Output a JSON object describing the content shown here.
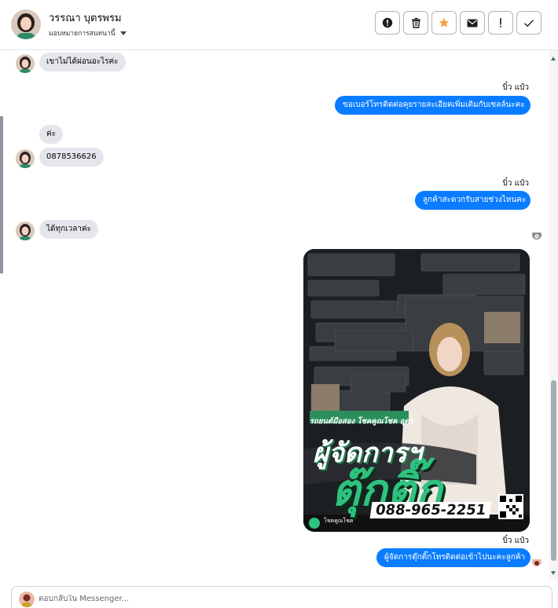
{
  "header": {
    "contact_name": "วรรณา บุตรพรม",
    "assign_label": "มอบหมายการสนทนานี้",
    "actions": [
      {
        "name": "report-button",
        "icon": "alert-circle-icon"
      },
      {
        "name": "delete-button",
        "icon": "trash-icon"
      },
      {
        "name": "star-button",
        "icon": "star-icon"
      },
      {
        "name": "mail-button",
        "icon": "envelope-icon"
      },
      {
        "name": "spam-button",
        "icon": "exclamation-icon"
      },
      {
        "name": "done-button",
        "icon": "check-icon"
      }
    ]
  },
  "colors": {
    "outgoing_bubble": "#0a7cff",
    "incoming_bubble": "#e4e6eb",
    "star": "#f7a13a",
    "poster_accent": "#2ec27e"
  },
  "messages": [
    {
      "from": "customer",
      "text": "เขาไม่ได้ผ่อนอะไรค่ะ"
    },
    {
      "from": "page",
      "sender": "บิ๋ว แป๋ว",
      "text": "ขอเบอร์โทรติดต่อคุยรายละเอียดเพิ่มเติมกับเซลล์นะคะ"
    },
    {
      "from": "customer",
      "text": "ค่ะ"
    },
    {
      "from": "customer",
      "text": "0878536626"
    },
    {
      "from": "page",
      "sender": "บิ๋ว แป๋ว",
      "text": "ลูกค้าสะดวกรับสายช่วงไหนคะ"
    },
    {
      "from": "customer",
      "text": "ได้ทุกเวลาค่ะ"
    },
    {
      "from": "page",
      "type": "image"
    },
    {
      "from": "page",
      "sender": "บิ๋ว แป๋ว",
      "text": "ผู้จัดการตุ๊กติ๊กโทรติดต่อเข้าไปนะคะลูกค้า"
    }
  ],
  "poster": {
    "headline": "รถยนต์มือสอง โชคคูณโชค อุดร",
    "title_line1": "ผู้จัดการฯ",
    "title_line2": "ตุ๊กติ๊ก",
    "phone": "088-965-2251",
    "brand": "โชคคูณโชค"
  },
  "composer": {
    "placeholder": "ตอบกลับใน Messenger..."
  }
}
